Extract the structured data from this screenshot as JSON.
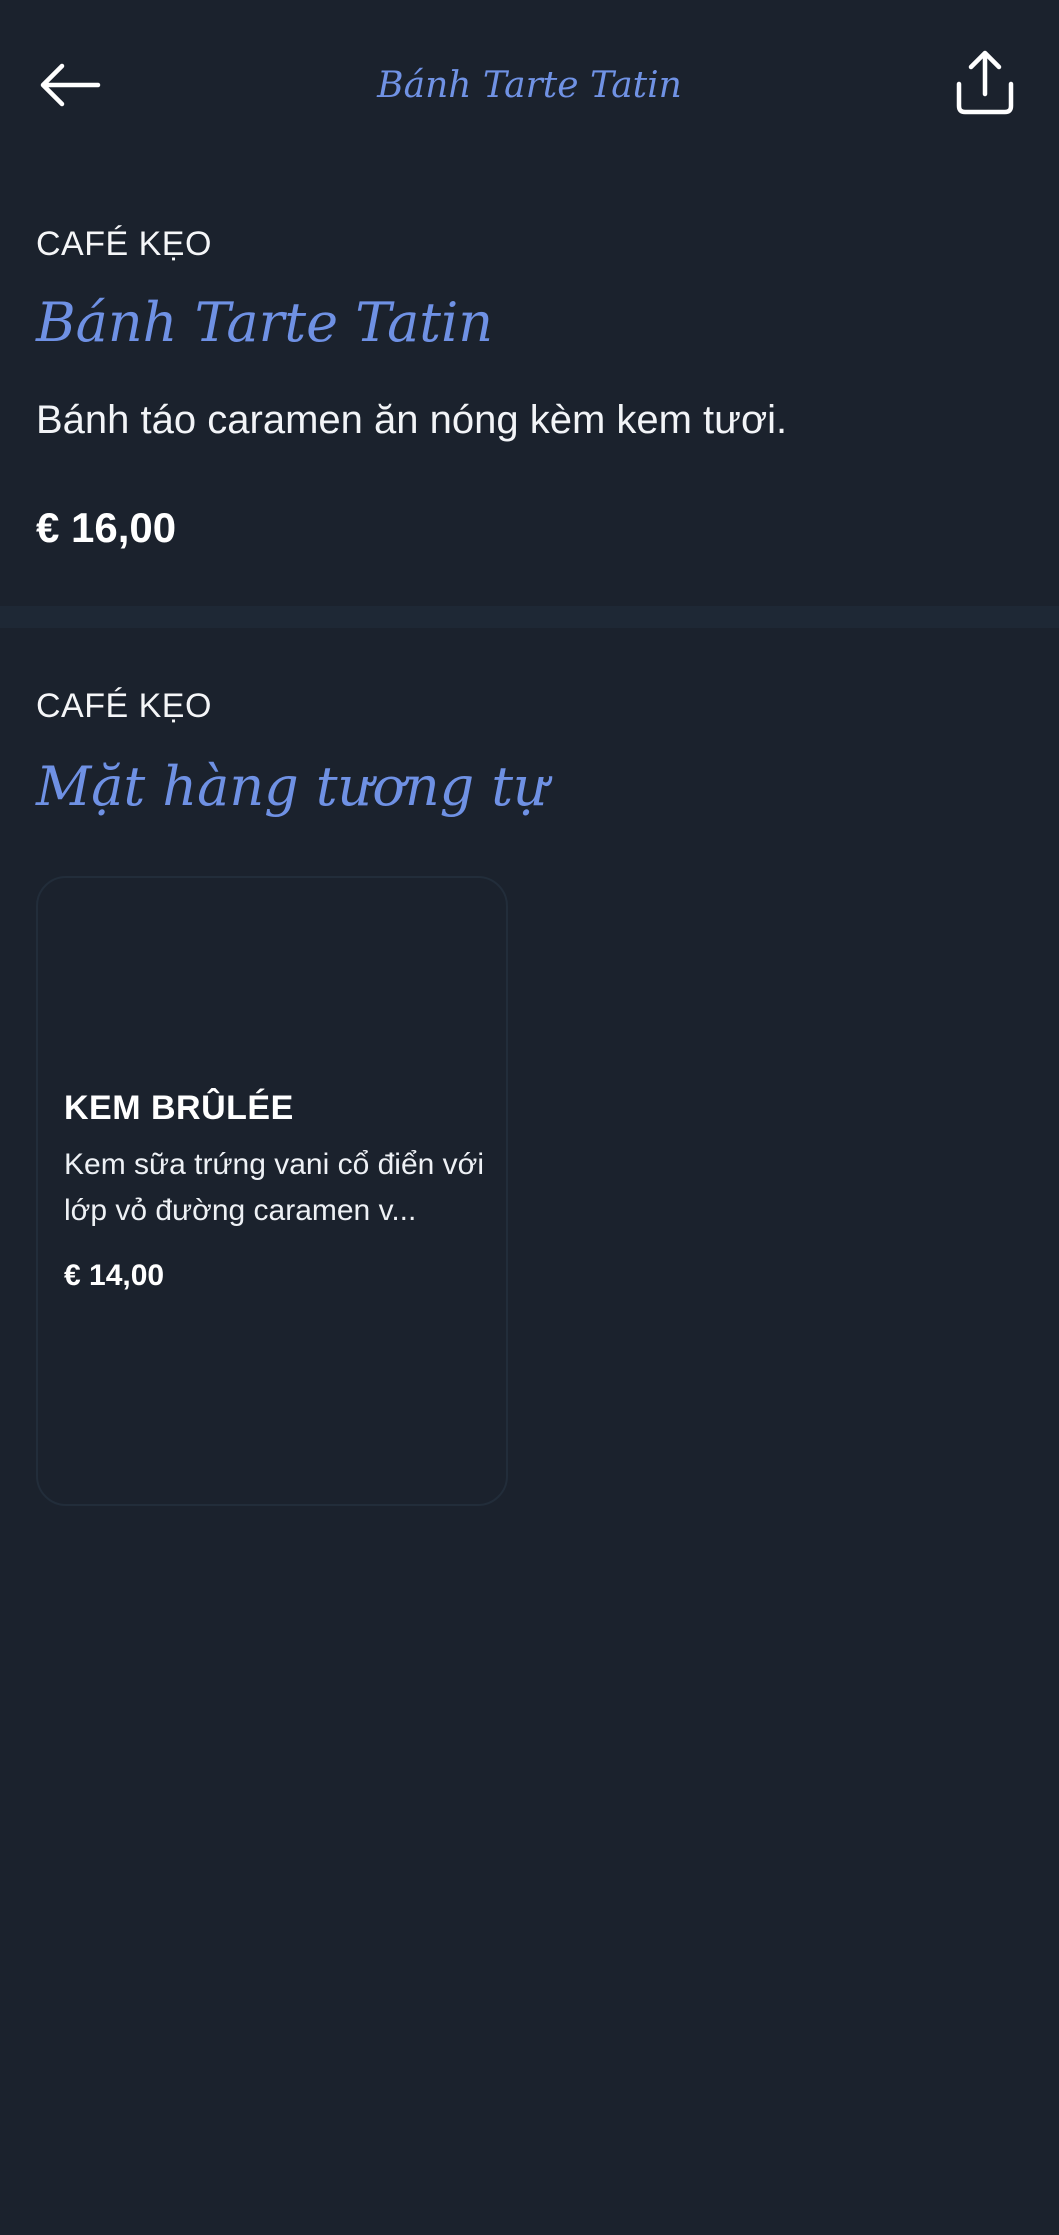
{
  "header": {
    "title": "Bánh Tarte Tatin",
    "back_icon": "arrow-left-icon",
    "share_icon": "share-upload-icon"
  },
  "product": {
    "category": "CAFÉ KẸO",
    "name": "Bánh Tarte Tatin",
    "description": "Bánh táo caramen ăn nóng kèm kem tươi.",
    "price": "€ 16,00"
  },
  "similar": {
    "category": "CAFÉ KẸO",
    "heading": "Mặt hàng tương tự",
    "items": [
      {
        "name": "KEM BRÛLÉE",
        "description": "Kem sữa trứng vani cổ điển với lớp vỏ đường caramen v...",
        "price": "€ 14,00"
      }
    ]
  },
  "colors": {
    "background": "#1b222d",
    "accent": "#6f91e4",
    "divider": "#1e2835",
    "card_border": "#222d3a"
  }
}
